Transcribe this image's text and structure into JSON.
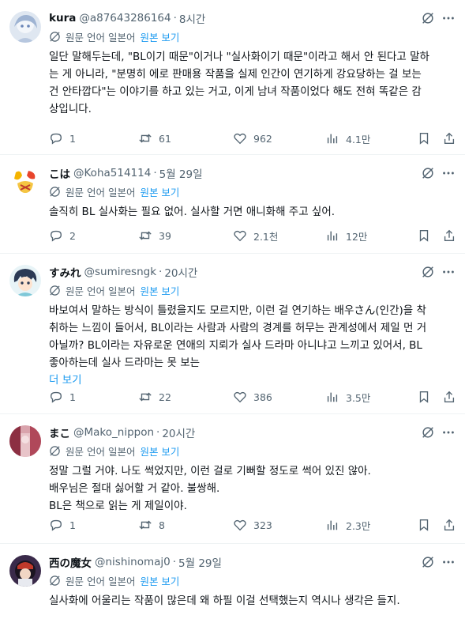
{
  "tweets": [
    {
      "name": "kura",
      "handle": "@a87643286164",
      "time": "8시간",
      "translation_label": "원문 언어 일본어",
      "show_original": "원본 보기",
      "body": [
        "일단 말해두는데, \"BL이기 때문\"이거나 \"실사화이기 때문\"이라고 해서 안 된다고 말하",
        "는 게 아니라, \"분명히 에로 판매용 작품을 실제 인간이 연기하게 강요당하는 걸 보는",
        "건 안타깝다\"는 이야기를 하고 있는 거고, 이게 남녀 작품이었다 해도 전혀 똑같은 감",
        "상입니다."
      ],
      "replies": "1",
      "retweets": "61",
      "likes": "962",
      "views": "4.1만",
      "avatar_color": "#c9d6e8"
    },
    {
      "name": "こは",
      "handle": "@Koha514114",
      "time": "5월 29일",
      "translation_label": "원문 언어 일본어",
      "show_original": "원본 보기",
      "body": [
        "솔직히 BL 실사화는 필요 없어. 실사할 거면 애니화해 주고 싶어."
      ],
      "replies": "2",
      "retweets": "39",
      "likes": "2.1천",
      "views": "12만",
      "avatar_color": "#f5c542"
    },
    {
      "name": "すみれ",
      "handle": "@sumiresngk",
      "time": "20시간",
      "translation_label": "원문 언어 일본어",
      "show_original": "원본 보기",
      "body": [
        "바보여서 말하는 방식이 틀렸을지도 모르지만, 이런 걸 연기하는 배우さん(인간)을 착",
        "취하는 느낌이 들어서, BL이라는 사람과 사람의 경계를 허무는 관계성에서 제일 먼 거",
        "아닐까? BL이라는 자유로운 연애의 지뢰가 실사 드라마 아니냐고 느끼고 있어서, BL",
        "좋아하는데 실사 드라마는 못 보는"
      ],
      "show_more": "더 보기",
      "replies": "1",
      "retweets": "22",
      "likes": "386",
      "views": "3.5만",
      "avatar_color": "#7fc8d8"
    },
    {
      "name": "まこ",
      "handle": "@Mako_nippon",
      "time": "20시간",
      "translation_label": "원문 언어 일본어",
      "show_original": "원본 보기",
      "body": [
        "정말 그럴 거야. 나도 썩었지만, 이런 걸로 기뻐할 정도로 썩어 있진 않아.",
        "배우님은 절대 싫어할 거 같아. 불쌍해.",
        "BL은 책으로 읽는 게 제일이야."
      ],
      "replies": "1",
      "retweets": "8",
      "likes": "323",
      "views": "2.3만",
      "avatar_color": "#b0485a"
    },
    {
      "name": "西の魔女",
      "handle": "@nishinomaj0",
      "time": "5월 29일",
      "translation_label": "원문 언어 일본어",
      "show_original": "원본 보기",
      "body": [
        "실사화에 어울리는 작품이 많은데 왜 하필 이걸 선택했는지 역시나 생각은 들지."
      ],
      "avatar_color": "#3a2a4a"
    }
  ],
  "colors": {
    "text": "#0f1419",
    "secondary": "#536471",
    "link": "#1d9bf0",
    "divider": "#eff3f4"
  },
  "icons": [
    "grok-icon",
    "more-icon",
    "globe-translate-icon",
    "reply-icon",
    "retweet-icon",
    "like-icon",
    "views-icon",
    "bookmark-icon",
    "share-icon"
  ]
}
